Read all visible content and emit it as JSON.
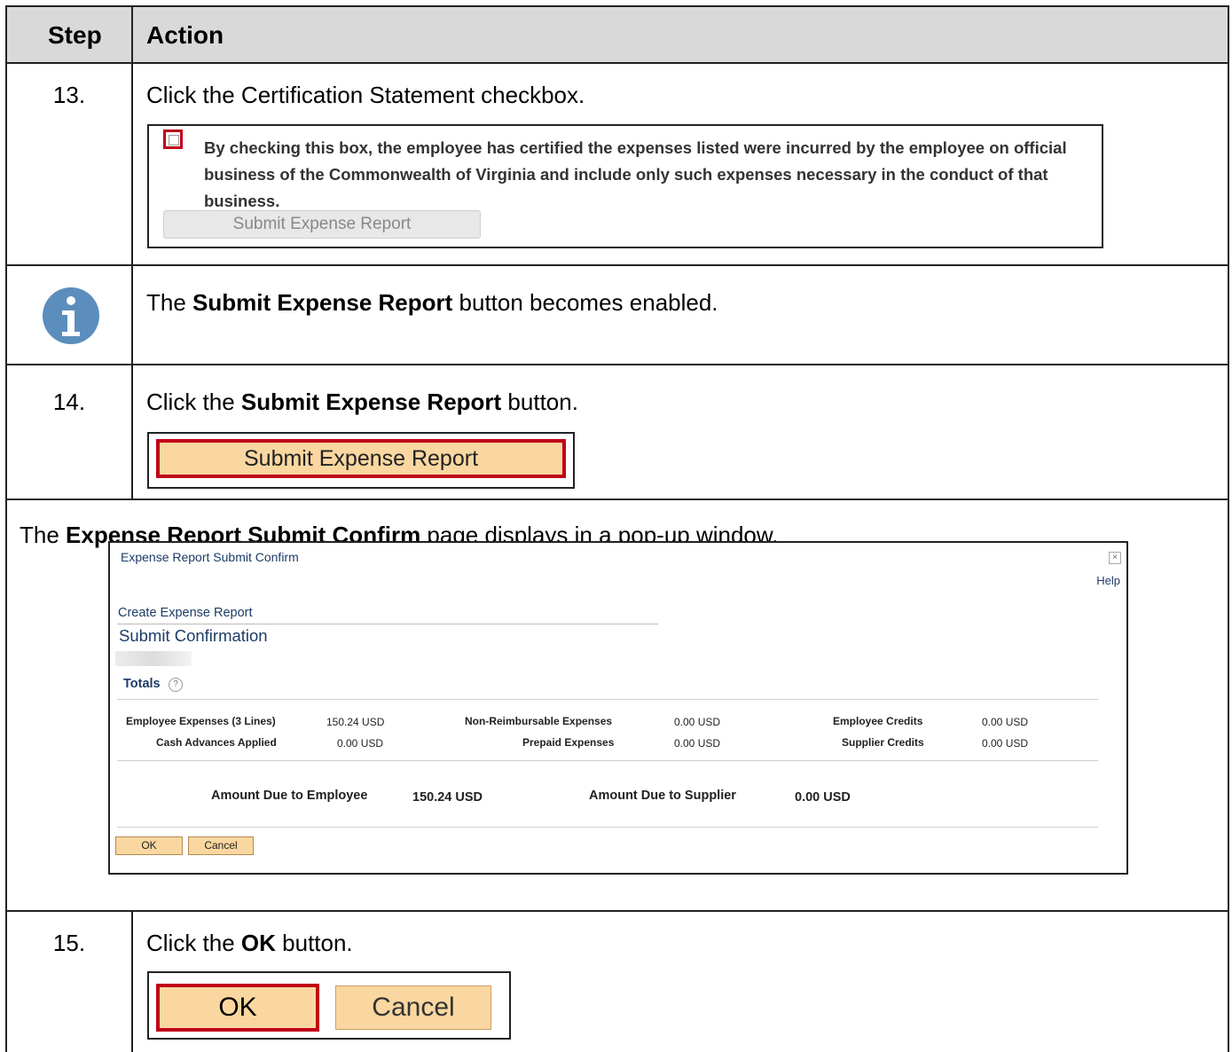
{
  "header": {
    "step": "Step",
    "action": "Action"
  },
  "step13": {
    "num": "13.",
    "text": "Click the Certification Statement checkbox.",
    "cert_text": "By checking this box, the employee has certified the expenses listed were incurred by the employee on official business of the Commonwealth of Virginia and include only such expenses necessary in the conduct of that business.",
    "button_label": "Submit Expense Report"
  },
  "info": {
    "pre": "The ",
    "bold": "Submit Expense Report",
    "post": " button becomes enabled.",
    "icon": "info-icon"
  },
  "step14": {
    "num": "14.",
    "pre": "Click the ",
    "bold": "Submit Expense Report",
    "post": " button.",
    "button_label": "Submit Expense Report"
  },
  "popup_intro": {
    "pre": "The ",
    "bold": "Expense Report Submit Confirm",
    "post": " page displays in a pop-up window."
  },
  "popup": {
    "title": "Expense Report Submit Confirm",
    "close": "×",
    "help": "Help",
    "breadcrumb": "Create Expense Report",
    "page_title": "Submit Confirmation",
    "totals_label": "Totals",
    "help_icon": "?",
    "employee_expenses_label": "Employee Expenses (3 Lines)",
    "employee_expenses_value": "150.24  USD",
    "cash_advances_label": "Cash Advances Applied",
    "cash_advances_value": "0.00  USD",
    "non_reimb_label": "Non-Reimbursable Expenses",
    "non_reimb_value": "0.00  USD",
    "prepaid_label": "Prepaid Expenses",
    "prepaid_value": "0.00  USD",
    "employee_credits_label": "Employee Credits",
    "employee_credits_value": "0.00  USD",
    "supplier_credits_label": "Supplier Credits",
    "supplier_credits_value": "0.00  USD",
    "due_employee_label": "Amount Due to Employee",
    "due_employee_value": "150.24  USD",
    "due_supplier_label": "Amount Due to Supplier",
    "due_supplier_value": "0.00  USD",
    "ok_label": "OK",
    "cancel_label": "Cancel"
  },
  "step15": {
    "num": "15.",
    "pre": "Click the ",
    "bold": "OK",
    "post": " button.",
    "ok_label": "OK",
    "cancel_label": "Cancel"
  },
  "colors": {
    "highlight_border": "#c00018",
    "button_fill": "#fad7a0",
    "header_bg": "#d9d9d9",
    "info_blue": "#5b8ebd"
  }
}
